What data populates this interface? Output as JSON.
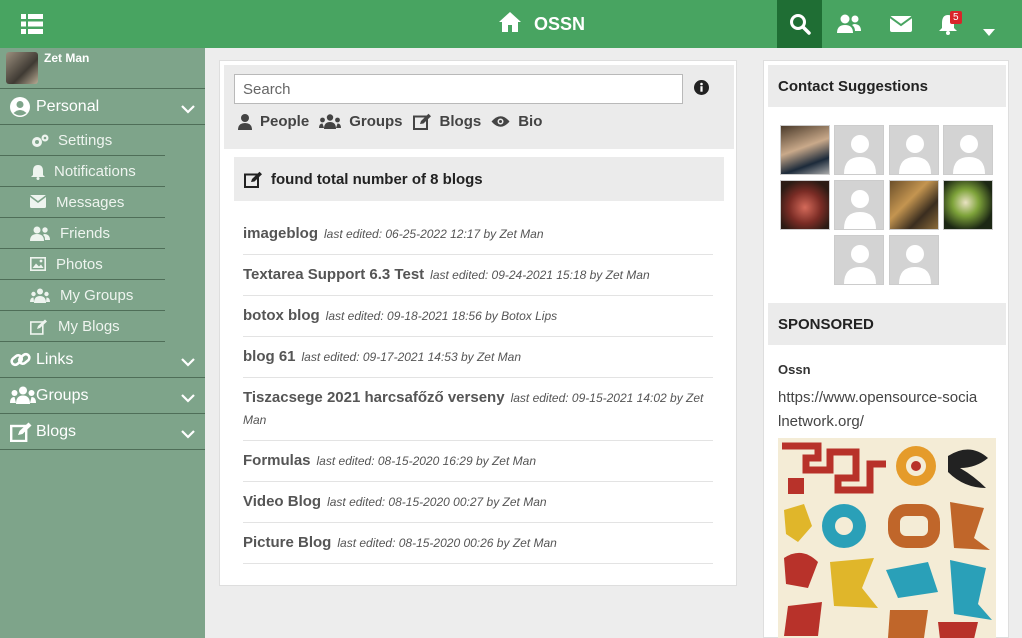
{
  "topbar": {
    "brand": "OSSN",
    "notification_count": "5",
    "colors": {
      "bar": "#48a461",
      "search_active": "#1f6e34",
      "badge": "#d9242a"
    }
  },
  "user": {
    "name": "Zet Man"
  },
  "sidebar": {
    "personal": {
      "label": "Personal",
      "items": [
        {
          "label": "Settings",
          "icon": "gears-icon"
        },
        {
          "label": "Notifications",
          "icon": "bell-icon"
        },
        {
          "label": "Messages",
          "icon": "envelope-icon"
        },
        {
          "label": "Friends",
          "icon": "users-icon"
        },
        {
          "label": "Photos",
          "icon": "image-icon"
        },
        {
          "label": "My Groups",
          "icon": "group-icon"
        },
        {
          "label": "My Blogs",
          "icon": "edit-icon"
        }
      ]
    },
    "links": {
      "label": "Links"
    },
    "groups": {
      "label": "Groups"
    },
    "blogs": {
      "label": "Blogs"
    }
  },
  "search": {
    "placeholder": "Search",
    "filters": [
      "People",
      "Groups",
      "Blogs",
      "Bio"
    ]
  },
  "results": {
    "summary": "found total number of 8 blogs",
    "blogs": [
      {
        "title": "imageblog",
        "meta": "last edited: 06-25-2022 12:17  by Zet Man"
      },
      {
        "title": "Textarea Support 6.3 Test",
        "meta": "last edited: 09-24-2021 15:18  by Zet Man"
      },
      {
        "title": "botox blog",
        "meta": "last edited: 09-18-2021 18:56  by Botox Lips"
      },
      {
        "title": "blog 61",
        "meta": "last edited: 09-17-2021 14:53  by Zet Man"
      },
      {
        "title": "Tiszacsege 2021 harcsafőző verseny",
        "meta": "last edited: 09-15-2021 14:02  by Zet Man"
      },
      {
        "title": "Formulas",
        "meta": "last edited: 08-15-2020 16:29  by Zet Man"
      },
      {
        "title": "Video Blog",
        "meta": "last edited: 08-15-2020 00:27  by Zet Man"
      },
      {
        "title": "Picture Blog",
        "meta": "last edited: 08-15-2020 00:26  by Zet Man"
      }
    ]
  },
  "contacts": {
    "title": "Contact Suggestions"
  },
  "sponsored": {
    "title": "SPONSORED",
    "name": "Ossn",
    "url": "https://www.opensource-socialnetwork.org/"
  }
}
